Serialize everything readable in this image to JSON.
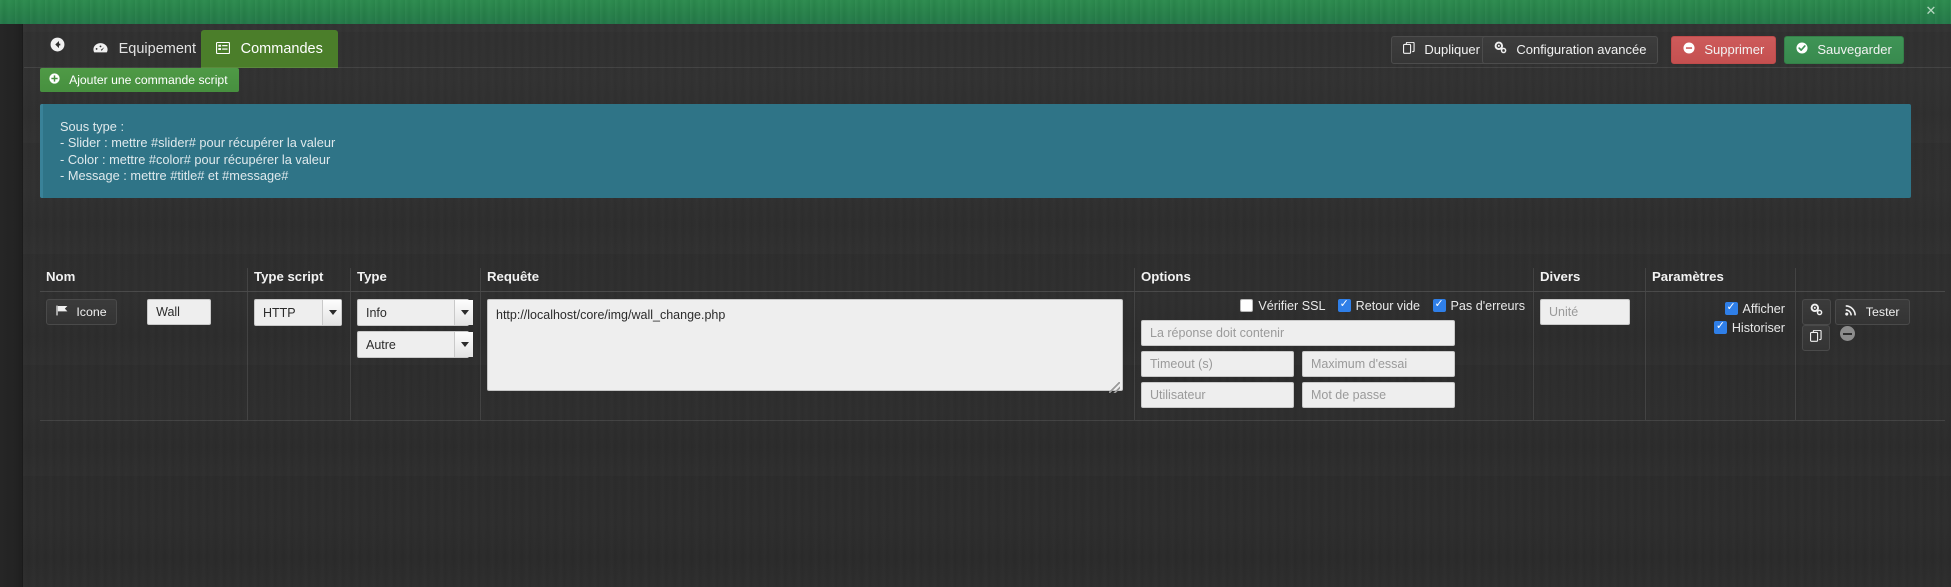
{
  "window": {
    "close_label": "✕"
  },
  "nav": {
    "back_icon": "back-arrow-icon",
    "tabs": [
      {
        "id": "equipement",
        "label": "Equipement",
        "icon": "dashboard-icon",
        "active": false
      },
      {
        "id": "commandes",
        "label": "Commandes",
        "icon": "list-icon",
        "active": true
      }
    ]
  },
  "header_actions": [
    {
      "id": "dupliquer",
      "label": "Dupliquer",
      "icon": "copy-icon",
      "style": "grey"
    },
    {
      "id": "config-av",
      "label": "Configuration avancée",
      "icon": "gears-icon",
      "style": "grey"
    },
    {
      "id": "supprimer",
      "label": "Supprimer",
      "icon": "minus-circle-icon",
      "style": "red"
    },
    {
      "id": "sauvegarder",
      "label": "Sauvegarder",
      "icon": "check-circle-icon",
      "style": "green"
    }
  ],
  "toolbar": {
    "add_command_label": "Ajouter une commande script",
    "add_command_icon": "plus-circle-icon"
  },
  "info_panel": {
    "lines": [
      "Sous type :",
      "- Slider : mettre #slider# pour récupérer la valeur",
      "- Color : mettre #color# pour récupérer la valeur",
      "- Message : mettre #title# et #message#"
    ]
  },
  "table": {
    "headers": {
      "nom": "Nom",
      "type_script": "Type script",
      "type": "Type",
      "requete": "Requête",
      "options": "Options",
      "divers": "Divers",
      "parametres": "Paramètres",
      "actions": ""
    },
    "row": {
      "icone_button": {
        "label": "Icone",
        "icon": "flag-icon"
      },
      "nom_value": "Wall",
      "nom_placeholder": "Nom",
      "type_script_value": "HTTP",
      "type_value": "Info",
      "subtype_value": "Autre",
      "requete_value": "http://localhost/core/img/wall_change.php",
      "options": {
        "checkboxes": [
          {
            "id": "verifier-ssl",
            "label": "Vérifier SSL",
            "checked": false
          },
          {
            "id": "retour-vide",
            "label": "Retour vide",
            "checked": true
          },
          {
            "id": "pas-erreurs",
            "label": "Pas d'erreurs",
            "checked": true
          }
        ],
        "reponse_placeholder": "La réponse doit contenir",
        "reponse_value": "",
        "timeout_placeholder": "Timeout (s)",
        "timeout_value": "",
        "max_essai_placeholder": "Maximum d'essai",
        "max_essai_value": "",
        "utilisateur_placeholder": "Utilisateur",
        "utilisateur_value": "",
        "motdepasse_placeholder": "Mot de passe",
        "motdepasse_value": ""
      },
      "divers": {
        "unite_placeholder": "Unité",
        "unite_value": ""
      },
      "parametres": [
        {
          "id": "afficher",
          "label": "Afficher",
          "checked": true
        },
        {
          "id": "historiser",
          "label": "Historiser",
          "checked": true
        }
      ],
      "actions": {
        "config_icon": "gears-icon",
        "tester_label": "Tester",
        "tester_icon": "rss-icon",
        "duplicate_icon": "copy-icon",
        "remove_icon": "minus-circle-icon"
      }
    }
  }
}
